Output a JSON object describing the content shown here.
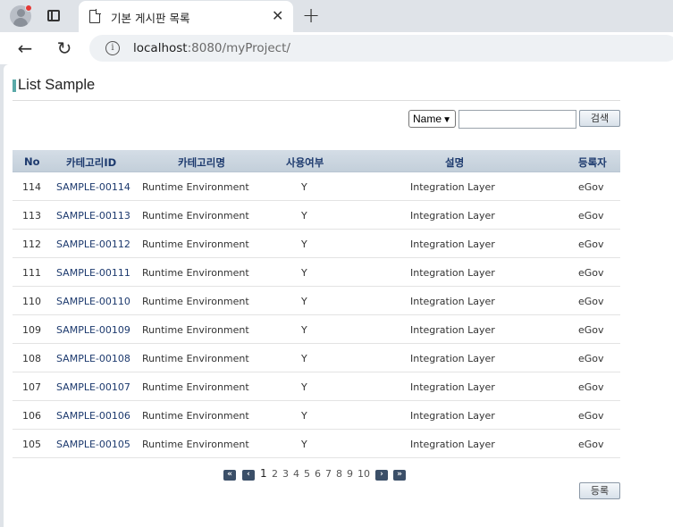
{
  "browser": {
    "tab_title": "기본 게시판 목록",
    "tab_close": "✕",
    "new_tab": "+",
    "url_host": "localhost",
    "url_rest": ":8080/myProject/"
  },
  "page": {
    "title": "List Sample",
    "search": {
      "select_value": "Name",
      "input_value": "",
      "button_label": "검색"
    },
    "table": {
      "headers": [
        "No",
        "카테고리ID",
        "카테고리명",
        "사용여부",
        "설명",
        "등록자"
      ],
      "rows": [
        {
          "no": "114",
          "id": "SAMPLE-00114",
          "name": "Runtime Environment",
          "use": "Y",
          "desc": "Integration Layer",
          "reg": "eGov"
        },
        {
          "no": "113",
          "id": "SAMPLE-00113",
          "name": "Runtime Environment",
          "use": "Y",
          "desc": "Integration Layer",
          "reg": "eGov"
        },
        {
          "no": "112",
          "id": "SAMPLE-00112",
          "name": "Runtime Environment",
          "use": "Y",
          "desc": "Integration Layer",
          "reg": "eGov"
        },
        {
          "no": "111",
          "id": "SAMPLE-00111",
          "name": "Runtime Environment",
          "use": "Y",
          "desc": "Integration Layer",
          "reg": "eGov"
        },
        {
          "no": "110",
          "id": "SAMPLE-00110",
          "name": "Runtime Environment",
          "use": "Y",
          "desc": "Integration Layer",
          "reg": "eGov"
        },
        {
          "no": "109",
          "id": "SAMPLE-00109",
          "name": "Runtime Environment",
          "use": "Y",
          "desc": "Integration Layer",
          "reg": "eGov"
        },
        {
          "no": "108",
          "id": "SAMPLE-00108",
          "name": "Runtime Environment",
          "use": "Y",
          "desc": "Integration Layer",
          "reg": "eGov"
        },
        {
          "no": "107",
          "id": "SAMPLE-00107",
          "name": "Runtime Environment",
          "use": "Y",
          "desc": "Integration Layer",
          "reg": "eGov"
        },
        {
          "no": "106",
          "id": "SAMPLE-00106",
          "name": "Runtime Environment",
          "use": "Y",
          "desc": "Integration Layer",
          "reg": "eGov"
        },
        {
          "no": "105",
          "id": "SAMPLE-00105",
          "name": "Runtime Environment",
          "use": "Y",
          "desc": "Integration Layer",
          "reg": "eGov"
        }
      ]
    },
    "pagination": {
      "first": "«",
      "prev": "‹",
      "pages": [
        "1",
        "2",
        "3",
        "4",
        "5",
        "6",
        "7",
        "8",
        "9",
        "10"
      ],
      "current": "1",
      "next": "›",
      "last": "»"
    },
    "register_label": "등록"
  },
  "icons": {
    "back": "arrow-left-icon",
    "reload": "reload-icon",
    "info": "info-icon",
    "tab": "document-icon"
  }
}
